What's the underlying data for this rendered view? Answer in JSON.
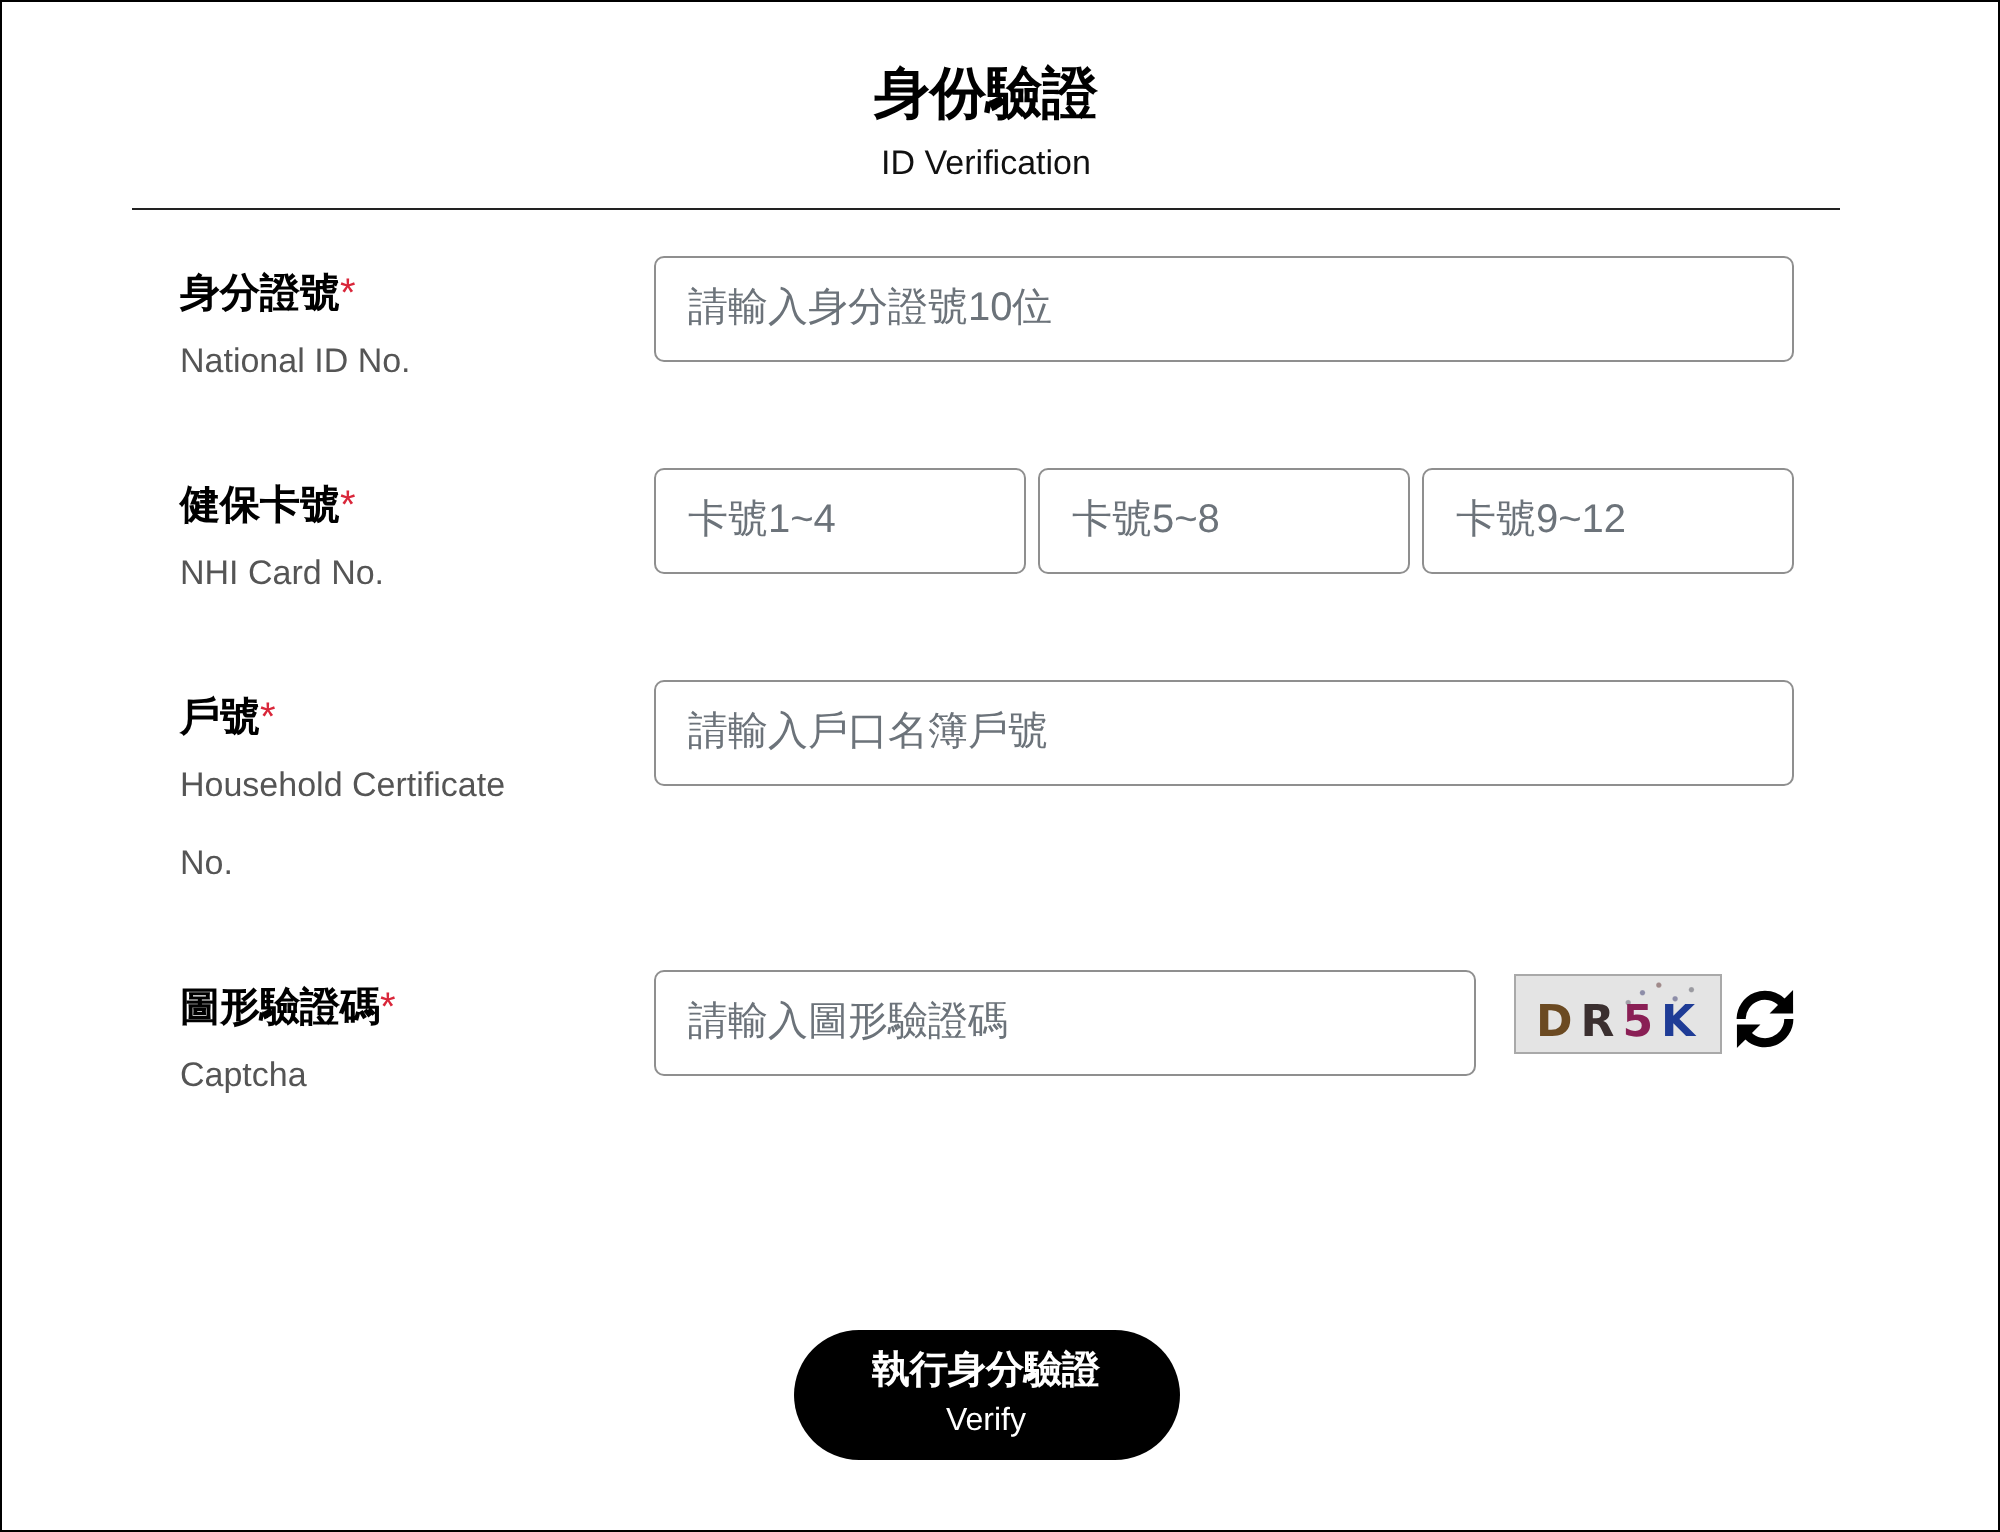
{
  "header": {
    "title": "身份驗證",
    "subtitle": "ID Verification"
  },
  "fields": [
    {
      "kind": "text",
      "label": "身分證號",
      "required_mark": "*",
      "label_en": "National ID No.",
      "inputs": [
        {
          "placeholder": "請輸入身分證號10位"
        }
      ]
    },
    {
      "kind": "split",
      "label": "健保卡號",
      "required_mark": "*",
      "label_en": "NHI Card No.",
      "inputs": [
        {
          "placeholder": "卡號1~4"
        },
        {
          "placeholder": "卡號5~8"
        },
        {
          "placeholder": "卡號9~12"
        }
      ]
    },
    {
      "kind": "text",
      "label": "戶號",
      "required_mark": "*",
      "label_en": "Household Certificate No.",
      "inputs": [
        {
          "placeholder": "請輸入戶口名簿戶號"
        }
      ]
    },
    {
      "kind": "captcha",
      "label": "圖形驗證碼",
      "required_mark": "*",
      "label_en": "Captcha",
      "inputs": [
        {
          "placeholder": "請輸入圖形驗證碼"
        }
      ],
      "captcha_text": "DR5K"
    }
  ],
  "submit": {
    "label": "執行身分驗證",
    "sublabel": "Verify"
  }
}
